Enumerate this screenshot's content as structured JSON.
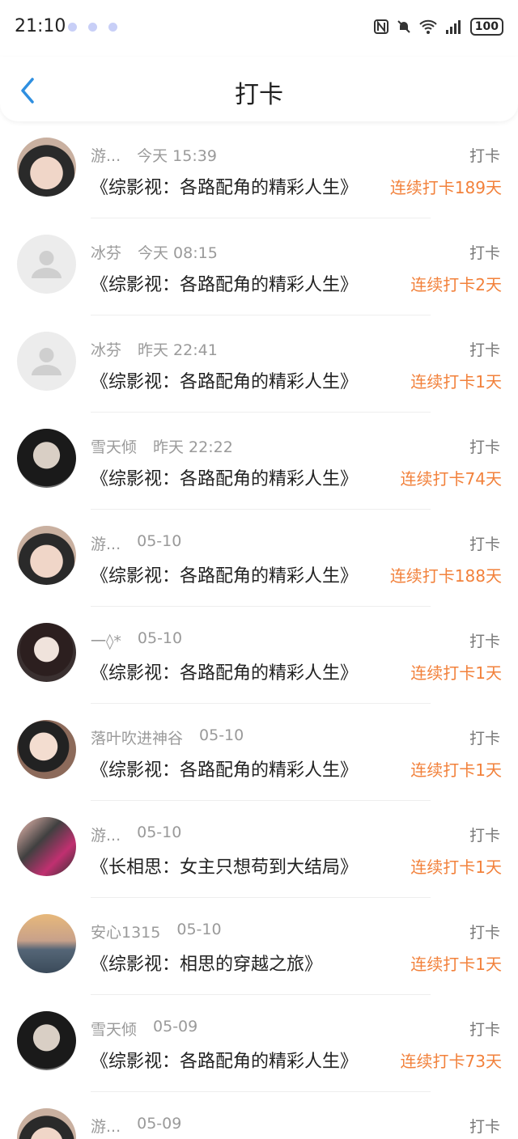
{
  "status_bar": {
    "time": "21:10",
    "battery": "100"
  },
  "header": {
    "title": "打卡"
  },
  "items": [
    {
      "name": "游...",
      "time": "今天 15:39",
      "book": "《综影视：各路配角的精彩人生》",
      "label": "打卡",
      "streak": "连续打卡189天",
      "avatar": "p1"
    },
    {
      "name": "冰芬",
      "time": "今天 08:15",
      "book": "《综影视：各路配角的精彩人生》",
      "label": "打卡",
      "streak": "连续打卡2天",
      "avatar": "placeholder"
    },
    {
      "name": "冰芬",
      "time": "昨天 22:41",
      "book": "《综影视：各路配角的精彩人生》",
      "label": "打卡",
      "streak": "连续打卡1天",
      "avatar": "placeholder"
    },
    {
      "name": "雪天倾",
      "time": "昨天 22:22",
      "book": "《综影视：各路配角的精彩人生》",
      "label": "打卡",
      "streak": "连续打卡74天",
      "avatar": "p2"
    },
    {
      "name": "游...",
      "time": "05-10",
      "book": "《综影视：各路配角的精彩人生》",
      "label": "打卡",
      "streak": "连续打卡188天",
      "avatar": "p1"
    },
    {
      "name": "一◊*",
      "time": "05-10",
      "book": "《综影视：各路配角的精彩人生》",
      "label": "打卡",
      "streak": "连续打卡1天",
      "avatar": "p3"
    },
    {
      "name": "落叶吹进神谷",
      "time": "05-10",
      "book": "《综影视：各路配角的精彩人生》",
      "label": "打卡",
      "streak": "连续打卡1天",
      "avatar": "p4"
    },
    {
      "name": "游...",
      "time": "05-10",
      "book": "《长相思：女主只想苟到大结局》",
      "label": "打卡",
      "streak": "连续打卡1天",
      "avatar": "p5"
    },
    {
      "name": "安心1315",
      "time": "05-10",
      "book": "《综影视：相思的穿越之旅》",
      "label": "打卡",
      "streak": "连续打卡1天",
      "avatar": "p6"
    },
    {
      "name": "雪天倾",
      "time": "05-09",
      "book": "《综影视：各路配角的精彩人生》",
      "label": "打卡",
      "streak": "连续打卡73天",
      "avatar": "p2"
    },
    {
      "name": "游...",
      "time": "05-09",
      "book": "",
      "label": "打卡",
      "streak": "",
      "avatar": "p1"
    }
  ]
}
